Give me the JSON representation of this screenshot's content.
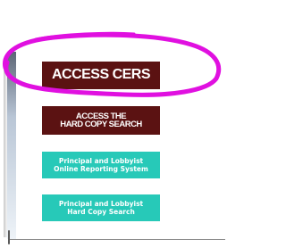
{
  "buttons": {
    "access_cers": "ACCESS CERS",
    "access_hard_copy_search": "ACCESS THE\nHARD COPY SEARCH",
    "online_reporting": "Principal and Lobbyist\nOnline Reporting System",
    "hard_copy_search": "Principal and Lobbyist\nHard Copy Search"
  },
  "colors": {
    "dark_button": "#5b1212",
    "teal_button": "#27c9b8",
    "annotation": "#e010e0"
  }
}
